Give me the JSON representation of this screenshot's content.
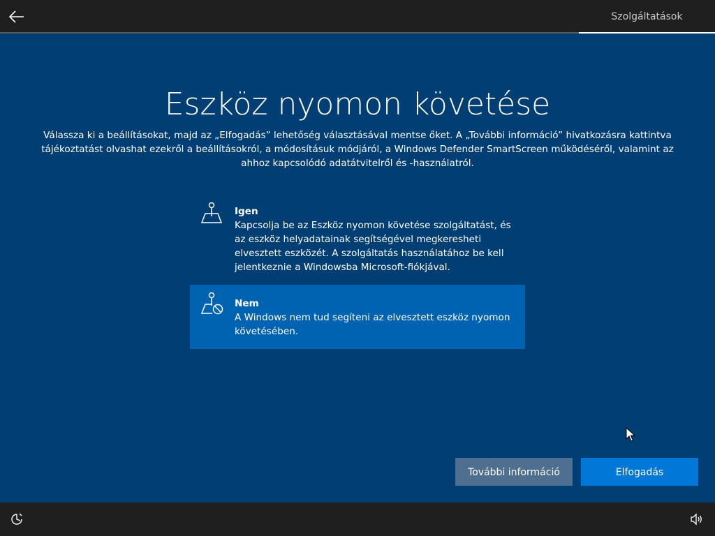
{
  "header": {
    "tab_label": "Szolgáltatások"
  },
  "page": {
    "title": "Eszköz nyomon követése",
    "description": "Válassza ki a beállításokat, majd az „Elfogadás” lehetőség választásával mentse őket. A „További információ” hivatkozásra kattintva tájékoztatást olvashat ezekről a beállításokról, a módosításuk módjáról, a Windows Defender SmartScreen működéséről, valamint az ahhoz kapcsolódó adatátvitelről és -használatról."
  },
  "options": [
    {
      "title": "Igen",
      "description": "Kapcsolja be az Eszköz nyomon követése szolgáltatást, és az eszköz helyadatainak segítségével megkeresheti elvesztett eszközét. A szolgáltatás használatához be kell jelentkeznie a Windowsba Microsoft-fiókjával.",
      "icon": "map-pin-icon",
      "selected": false
    },
    {
      "title": "Nem",
      "description": "A Windows nem tud segíteni az elvesztett eszköz nyomon követésében.",
      "icon": "map-pin-blocked-icon",
      "selected": true
    }
  ],
  "buttons": {
    "more_info": "További információ",
    "accept": "Elfogadás"
  },
  "colors": {
    "background": "#003e73",
    "selected": "#0063b1",
    "primary_button": "#0078d7",
    "secondary_button": "#4f6f90",
    "bars": "#1f1f1f"
  }
}
